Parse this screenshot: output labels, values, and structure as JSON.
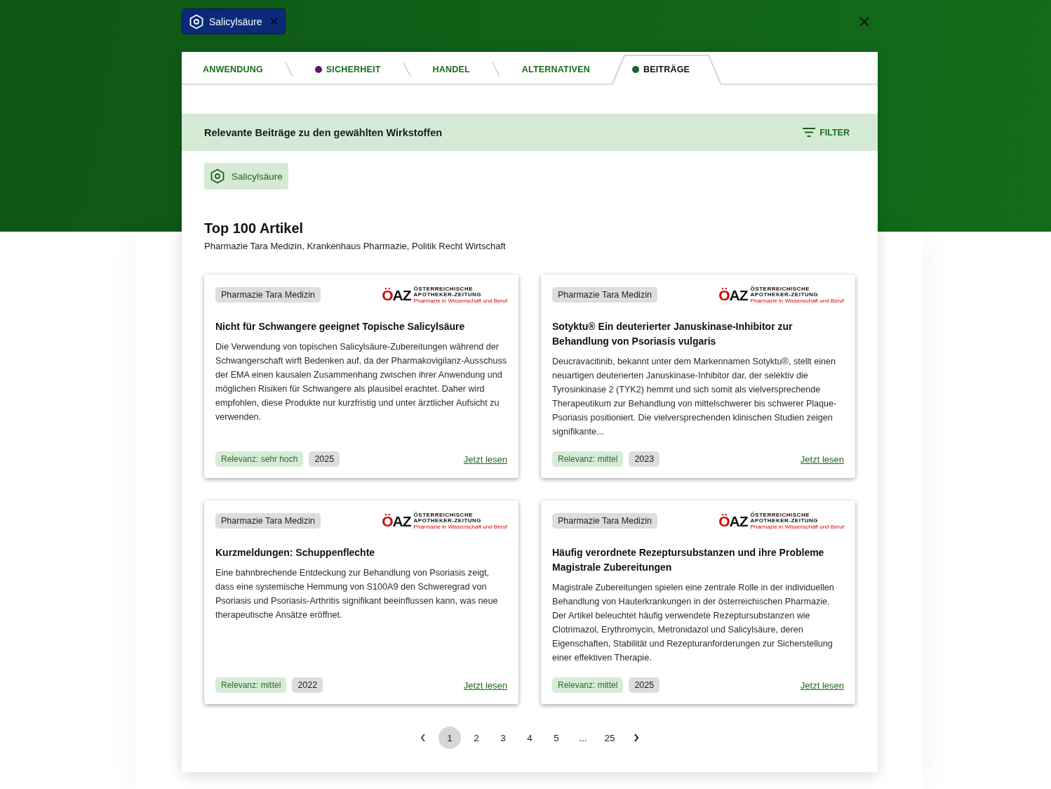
{
  "selected_substance": {
    "label": "Salicylsäure"
  },
  "tabs": [
    {
      "label": "ANWENDUNG",
      "selected": false
    },
    {
      "label": "SICHERHEIT",
      "selected": false,
      "color": "#5e1668"
    },
    {
      "label": "HANDEL",
      "selected": false
    },
    {
      "label": "ALTERNATIVEN",
      "selected": false
    },
    {
      "label": "BEITRÄGE",
      "selected": true,
      "color": "#1d5e2a"
    }
  ],
  "section_header": {
    "title": "Relevante Beiträge zu den gewählten Wirkstoffen",
    "filter_label": "FILTER"
  },
  "substance_chips": [
    {
      "label": "Salicylsäure"
    }
  ],
  "top_articles": {
    "title": "Top 100 Artikel",
    "subtitle": "Pharmazie Tara Medizin, Krankenhaus Pharmazie, Politik Recht Wirtschaft"
  },
  "articles": [
    {
      "category": "Pharmazie Tara Medizin",
      "logo": {
        "mark": "ÖAZ",
        "line_1": "ÖSTERREICHISCHE",
        "line_2": "APOTHEKER-ZEITUNG",
        "tagline": "Pharmazie in Wissenschaft und Beruf"
      },
      "title": "Nicht für Schwangere geeignet Topische Salicylsäure",
      "summary": "Die Verwendung von topischen Salicylsäure-Zubereitungen während der Schwangerschaft wirft Bedenken auf, da der Pharmakovigilanz-Ausschuss der EMA einen kausalen Zusammenhang zwischen ihrer Anwendung und möglichen Risiken für Schwangere als plausibel erachtet. Daher wird empfohlen, diese Produkte nur kurzfristig und unter ärztlicher Aufsicht zu verwenden.",
      "relevance": "Relevanz: sehr hoch",
      "year": "2025",
      "link": "Jetzt lesen"
    },
    {
      "category": "Pharmazie Tara Medizin",
      "logo": {
        "mark": "ÖAZ",
        "line_1": "ÖSTERREICHISCHE",
        "line_2": "APOTHEKER-ZEITUNG",
        "tagline": "Pharmazie in Wissenschaft und Beruf"
      },
      "title": "Sotyktu® Ein deuterierter Januskinase-Inhibitor zur Behandlung von Psoriasis vulgaris",
      "summary": "Deucravacitinib, bekannt unter dem Markennamen Sotyktu®, stellt einen neuartigen deuterierten Januskinase-Inhibitor dar, der selektiv die Tyrosinkinase 2 (TYK2) hemmt und sich somit als vielversprechende Therapeutikum zur Behandlung von mittelschwerer bis schwerer Plaque-Psoriasis positioniert. Die vielversprechenden klinischen Studien zeigen signifikante...",
      "relevance": "Relevanz: mittel",
      "year": "2023",
      "link": "Jetzt lesen"
    },
    {
      "category": "Pharmazie Tara Medizin",
      "logo": {
        "mark": "ÖAZ",
        "line_1": "ÖSTERREICHISCHE",
        "line_2": "APOTHEKER-ZEITUNG",
        "tagline": "Pharmazie in Wissenschaft und Beruf"
      },
      "title": "Kurzmeldungen: Schuppenflechte",
      "summary": "Eine bahnbrechende Entdeckung zur Behandlung von Psoriasis zeigt, dass eine systemische Hemmung von S100A9 den Schweregrad von Psoriasis und Psoriasis-Arthritis signifikant beeinflussen kann, was neue therapeutische Ansätze eröffnet.",
      "relevance": "Relevanz: mittel",
      "year": "2022",
      "link": "Jetzt lesen"
    },
    {
      "category": "Pharmazie Tara Medizin",
      "logo": {
        "mark": "ÖAZ",
        "line_1": "ÖSTERREICHISCHE",
        "line_2": "APOTHEKER-ZEITUNG",
        "tagline": "Pharmazie in Wissenschaft und Beruf"
      },
      "title": "Häufig verordnete Rezeptursubstanzen und ihre Probleme Magistrale Zubereitungen",
      "summary": "Magistrale Zubereitungen spielen eine zentrale Rolle in der individuellen Behandlung von Hauterkrankungen in der österreichischen Pharmazie. Der Artikel beleuchtet häufig verwendete Rezeptursubstanzen wie Clotrimazol, Erythromycin, Metronidazol und Salicylsäure, deren Eigenschaften, Stabilität und Rezepturanforderungen zur Sicherstellung einer effektiven Therapie.",
      "relevance": "Relevanz: mittel",
      "year": "2025",
      "link": "Jetzt lesen"
    }
  ],
  "pagination": {
    "pages": [
      {
        "label": "1",
        "selected": true
      },
      {
        "label": "2",
        "selected": false
      },
      {
        "label": "3",
        "selected": false
      },
      {
        "label": "4",
        "selected": false
      },
      {
        "label": "5",
        "selected": false
      },
      {
        "label": "...",
        "selected": false
      },
      {
        "label": "25",
        "selected": false
      }
    ]
  }
}
